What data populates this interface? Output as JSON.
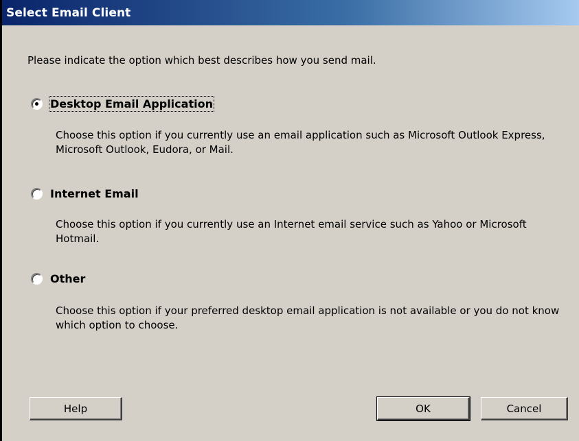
{
  "dialog": {
    "title": "Select Email Client",
    "intro": "Please indicate the option which best describes how you send mail."
  },
  "options": [
    {
      "label": "Desktop Email Application",
      "description": "Choose this option if you currently use an email application such as Microsoft Outlook Express, Microsoft Outlook, Eudora, or Mail.",
      "selected": true
    },
    {
      "label": "Internet Email",
      "description": "Choose this option if you currently use an Internet email service such as Yahoo or Microsoft Hotmail.",
      "selected": false
    },
    {
      "label": "Other",
      "description": "Choose this option if your preferred desktop email application is not available or you do not know which option to choose.",
      "selected": false
    }
  ],
  "buttons": {
    "help": "Help",
    "ok": "OK",
    "cancel": "Cancel"
  },
  "colors": {
    "face": "#d4d0c8",
    "title_start": "#0a246a",
    "title_end": "#a6caf0"
  }
}
